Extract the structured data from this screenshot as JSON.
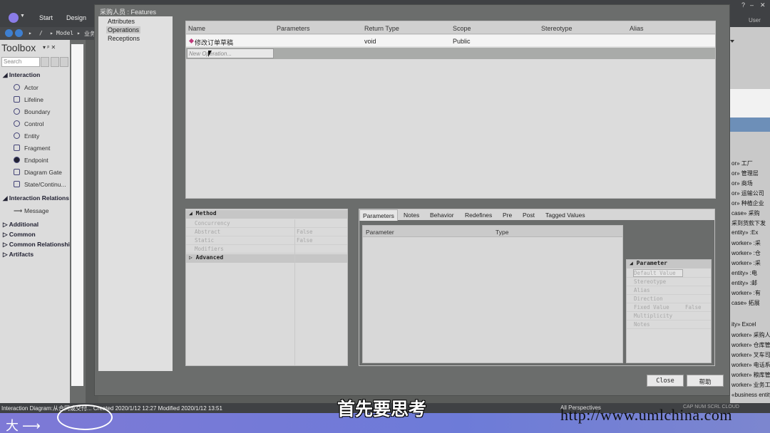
{
  "app": {
    "menu": [
      "Start",
      "Design"
    ],
    "nav_path": [
      "/",
      "Model",
      "业务"
    ],
    "window_controls": [
      "?",
      "–",
      "✕"
    ],
    "user": "User"
  },
  "toolbox": {
    "title": "Toolbox",
    "title_tools": "▾ ᵖ ✕",
    "search_placeholder": "Search",
    "groups": [
      {
        "label": "Interaction",
        "items": [
          "Actor",
          "Lifeline",
          "Boundary",
          "Control",
          "Entity",
          "Fragment",
          "Endpoint",
          "Diagram Gate",
          "State/Continu..."
        ]
      },
      {
        "label": "Interaction Relations",
        "items": [
          "Message"
        ]
      },
      {
        "label": "Additional",
        "items": []
      },
      {
        "label": "Common",
        "items": []
      },
      {
        "label": "Common Relationshi",
        "items": []
      },
      {
        "label": "Artifacts",
        "items": []
      }
    ]
  },
  "dialog": {
    "title": "采购人员 : Features",
    "nav": [
      "Attributes",
      "Operations",
      "Receptions"
    ],
    "grid": {
      "columns": [
        "Name",
        "Parameters",
        "Return Type",
        "Scope",
        "Stereotype",
        "Alias"
      ],
      "rows": [
        {
          "name": "修改订单草稿",
          "parameters": "",
          "return_type": "void",
          "scope": "Public",
          "stereotype": "",
          "alias": ""
        }
      ],
      "new_placeholder": "New Operation..."
    },
    "method_props": {
      "section": "Method",
      "rows": [
        {
          "key": "Concurrency",
          "value": ""
        },
        {
          "key": "Abstract",
          "value": "False"
        },
        {
          "key": "Static",
          "value": "False"
        },
        {
          "key": "Modifiers",
          "value": ""
        }
      ],
      "advanced": "Advanced"
    },
    "tabs": [
      "Parameters",
      "Notes",
      "Behavior",
      "Redefines",
      "Pre",
      "Post",
      "Tagged Values"
    ],
    "param_columns": [
      "Parameter",
      "Type"
    ],
    "param_props": {
      "section": "Parameter",
      "rows": [
        {
          "key": "Default Value",
          "value": ""
        },
        {
          "key": "Stereotype",
          "value": ""
        },
        {
          "key": "Alias",
          "value": ""
        },
        {
          "key": "Direction",
          "value": ""
        },
        {
          "key": "Fixed Value",
          "value": "False"
        },
        {
          "key": "Multiplicity",
          "value": ""
        },
        {
          "key": "Notes",
          "value": ""
        }
      ]
    },
    "buttons": {
      "close": "Close",
      "help": "帮助"
    }
  },
  "right_panel": {
    "lines": [
      "or» 工厂",
      "or» 管理层",
      "or» 商场",
      "or» 运输公司",
      "or» 种植企业",
      "case» 采购",
      "采到货款下发",
      "entity» :Ex",
      "worker» :采",
      "worker» :仓",
      "worker» :采",
      "entity» :电",
      "entity» :邮",
      "worker» :有",
      "case» 拓展",
      "",
      "ity» Excel",
      "worker» 采购人",
      "worker» 仓库管",
      "worker» 叉车司",
      "worker» 电话系",
      "worker» 粮库管",
      "worker» 业务工",
      "«business entity» 业务实"
    ]
  },
  "status": {
    "left": "Interaction Diagram:从合同或交付... Created 2020/1/12 12:27 Modified 2020/1/12 13:51",
    "perspectives": "All Perspectives",
    "indicators": "CAP  NUM  SCRL  CLOUD"
  },
  "overlay": {
    "subtitle": "首先要思考",
    "watermark": "http://www.umlchina.com"
  }
}
